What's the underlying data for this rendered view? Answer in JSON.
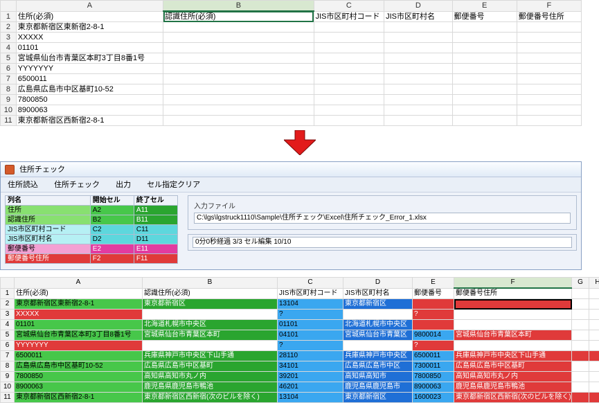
{
  "top": {
    "columns": [
      "A",
      "B",
      "C",
      "D",
      "E",
      "F"
    ],
    "selected_col_index": 1,
    "header_row": [
      "住所(必須)",
      "認識住所(必須)",
      "JIS市区町村コード",
      "JIS市区町村名",
      "郵便番号",
      "郵便番号住所"
    ],
    "rows": [
      "東京都新宿区東新宿2-8-1",
      "XXXXX",
      "01101",
      "宮城県仙台市青葉区本町3丁目8番1号",
      "YYYYYYY",
      "6500011",
      "広島県広島市中区基町10-52",
      "7800850",
      "8900063",
      "東京都新宿区西新宿2-8-1"
    ]
  },
  "app": {
    "title": "住所チェック",
    "menus": [
      "住所読込",
      "住所チェック",
      "出力",
      "セル指定クリア"
    ],
    "cfg_headers": [
      "列名",
      "開始セル",
      "終了セル"
    ],
    "cfg_rows": [
      {
        "name": "住所",
        "start": "A2",
        "end": "A11",
        "cls": [
          "grn0",
          "grn1",
          "grn2"
        ]
      },
      {
        "name": "認識住所",
        "start": "B2",
        "end": "B11",
        "cls": [
          "grn0",
          "grn1",
          "grn2"
        ]
      },
      {
        "name": "JIS市区町村コード",
        "start": "C2",
        "end": "C11",
        "cls": [
          "cyn0",
          "cyn1",
          "cyn1"
        ]
      },
      {
        "name": "JIS市区町村名",
        "start": "D2",
        "end": "D11",
        "cls": [
          "cyn0",
          "cyn1",
          "cyn1"
        ]
      },
      {
        "name": "郵便番号",
        "start": "E2",
        "end": "E11",
        "cls": [
          "mag0",
          "mag1",
          "mag1"
        ]
      },
      {
        "name": "郵便番号住所",
        "start": "F2",
        "end": "F11",
        "cls": [
          "red0",
          "red0",
          "red0"
        ]
      }
    ],
    "input_group_label": "入力ファイル",
    "input_path": "C:\\lgs\\lgstruck1110\\Sample\\住所チェック\\Excel\\住所チェック_Error_1.xlsx",
    "status": "0分0秒経過 3/3 セル編集 10/10"
  },
  "bottom": {
    "columns": [
      "A",
      "B",
      "C",
      "D",
      "E",
      "F",
      "G",
      "H"
    ],
    "selected_col_index": 5,
    "header_row": [
      "住所(必須)",
      "認識住所(必須)",
      "JIS市区町村コード",
      "JIS市区町村名",
      "郵便番号",
      "郵便番号住所",
      "",
      ""
    ],
    "rows": [
      {
        "a": "東京都新宿区東新宿2-8-1",
        "b": "東京都新宿区",
        "c": "13104",
        "d": "東京都新宿区",
        "e": "",
        "f": "",
        "style": {
          "a": "cell-grn",
          "b": "cell-dgrn",
          "c": "cell-blu",
          "d": "cell-dblu",
          "e": "cell-red",
          "f": "cell-red cell-sel"
        }
      },
      {
        "a": "XXXXX",
        "b": "",
        "c": "?",
        "d": "",
        "e": "?",
        "f": "",
        "style": {
          "a": "cell-red",
          "b": "",
          "c": "cell-blu",
          "d": "",
          "e": "cell-red",
          "f": ""
        }
      },
      {
        "a": "01101",
        "b": "北海道札幌市中央区",
        "c": "01101",
        "d": "北海道札幌市中央区",
        "e": "",
        "f": "",
        "style": {
          "a": "cell-grn",
          "b": "cell-dgrn",
          "c": "cell-blu",
          "d": "cell-dblu",
          "e": "cell-red",
          "f": ""
        }
      },
      {
        "a": "宮城県仙台市青葉区本町3丁目8番1号",
        "b": "宮城県仙台市青葉区本町",
        "c": "04101",
        "d": "宮城県仙台市青葉区",
        "e": "9800014",
        "f": "宮城県仙台市青葉区本町",
        "style": {
          "a": "cell-grn",
          "b": "cell-dgrn",
          "c": "cell-blu",
          "d": "cell-dblu",
          "e": "cell-blu",
          "f": "cell-red"
        }
      },
      {
        "a": "YYYYYYY",
        "b": "",
        "c": "?",
        "d": "",
        "e": "?",
        "f": "",
        "style": {
          "a": "cell-red",
          "b": "",
          "c": "cell-blu",
          "d": "",
          "e": "cell-red",
          "f": ""
        }
      },
      {
        "a": "6500011",
        "b": "兵庫県神戸市中央区下山手通",
        "c": "28110",
        "d": "兵庫県神戸市中央区",
        "e": "6500011",
        "f": "兵庫県神戸市中央区下山手通",
        "style": {
          "a": "cell-grn",
          "b": "cell-dgrn",
          "c": "cell-blu",
          "d": "cell-dblu",
          "e": "cell-blu",
          "f": "cell-red",
          "spill": "cell-red"
        }
      },
      {
        "a": "広島県広島市中区基町10-52",
        "b": "広島県広島市中区基町",
        "c": "34101",
        "d": "広島県広島市中区",
        "e": "7300011",
        "f": "広島県広島市中区基町",
        "style": {
          "a": "cell-grn",
          "b": "cell-dgrn",
          "c": "cell-blu",
          "d": "cell-dblu",
          "e": "cell-blu",
          "f": "cell-red"
        }
      },
      {
        "a": "7800850",
        "b": "高知県高知市丸ノ内",
        "c": "39201",
        "d": "高知県高知市",
        "e": "7800850",
        "f": "高知県高知市丸ノ内",
        "style": {
          "a": "cell-grn",
          "b": "cell-dgrn",
          "c": "cell-blu",
          "d": "cell-dblu",
          "e": "cell-blu",
          "f": "cell-red"
        }
      },
      {
        "a": "8900063",
        "b": "鹿児島県鹿児島市鴨池",
        "c": "46201",
        "d": "鹿児島県鹿児島市",
        "e": "8900063",
        "f": "鹿児島県鹿児島市鴨池",
        "style": {
          "a": "cell-grn",
          "b": "cell-dgrn",
          "c": "cell-blu",
          "d": "cell-dblu",
          "e": "cell-blu",
          "f": "cell-red"
        }
      },
      {
        "a": "東京都新宿区西新宿2-8-1",
        "b": "東京都新宿区西新宿(次のビルを除く)",
        "c": "13104",
        "d": "東京都新宿区",
        "e": "1600023",
        "f": "東京都新宿区西新宿(次のビルを除く)",
        "style": {
          "a": "cell-grn",
          "b": "cell-dgrn",
          "c": "cell-blu",
          "d": "cell-dblu",
          "e": "cell-blu",
          "f": "cell-red",
          "spill": "cell-red"
        }
      }
    ]
  }
}
